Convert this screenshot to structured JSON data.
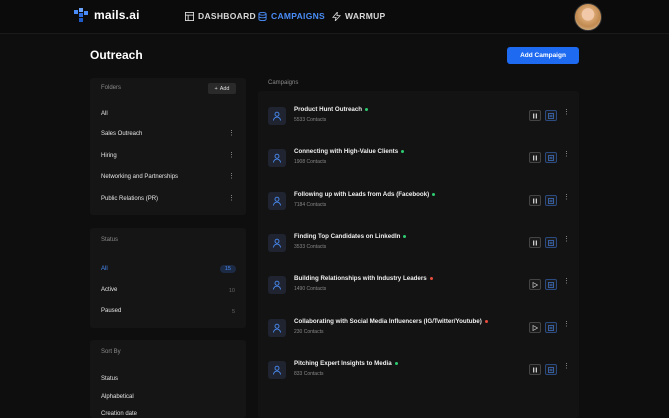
{
  "brand": {
    "name": "mails.ai"
  },
  "nav": {
    "dashboard": "DASHBOARD",
    "campaigns": "CAMPAIGNS",
    "warmup": "WARMUP"
  },
  "page": {
    "title": "Outreach",
    "add_campaign": "Add Campaign"
  },
  "folders": {
    "heading": "Folders",
    "add_label": "Add",
    "items": [
      "All",
      "Sales Outreach",
      "Hiring",
      "Networking and Partnerships",
      "Public Relations (PR)"
    ]
  },
  "status": {
    "heading": "Status",
    "items": [
      {
        "label": "All",
        "count": "15"
      },
      {
        "label": "Active",
        "count": "10"
      },
      {
        "label": "Paused",
        "count": "5"
      }
    ]
  },
  "sort": {
    "heading": "Sort By",
    "items": [
      "Status",
      "Alphabetical",
      "Creation date"
    ]
  },
  "campaigns": {
    "heading": "Campaigns",
    "items": [
      {
        "title": "Product Hunt Outreach",
        "contacts": "5533 Contacts",
        "status": "active"
      },
      {
        "title": "Connecting with High-Value Clients",
        "contacts": "1908 Contacts",
        "status": "active"
      },
      {
        "title": "Following up with Leads from Ads (Facebook)",
        "contacts": "7184 Contacts",
        "status": "active"
      },
      {
        "title": "Finding Top Candidates on LinkedIn",
        "contacts": "3533 Contacts",
        "status": "active"
      },
      {
        "title": "Building Relationships with Industry Leaders",
        "contacts": "1490 Contacts",
        "status": "paused"
      },
      {
        "title": "Collaborating with Social Media Influencers (IG/Twitter/Youtube)",
        "contacts": "230 Contacts",
        "status": "paused"
      },
      {
        "title": "Pitching Expert Insights to Media",
        "contacts": "833 Contacts",
        "status": "active"
      }
    ]
  },
  "colors": {
    "accent": "#1e6af0",
    "active_dot": "#2ecc71",
    "paused_dot": "#e74c3c"
  },
  "icons": {
    "pause": "pause-icon",
    "play": "play-icon",
    "stats": "stats-icon",
    "more": "more-icon",
    "user": "user-icon"
  }
}
